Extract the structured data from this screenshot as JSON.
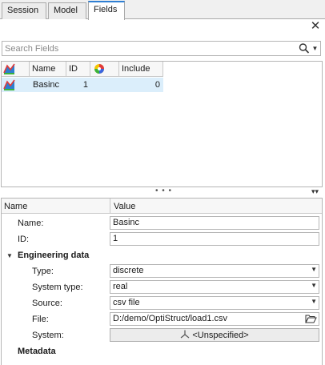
{
  "tabs": [
    {
      "label": "Session"
    },
    {
      "label": "Model"
    },
    {
      "label": "Fields",
      "active": true
    }
  ],
  "search": {
    "placeholder": "Search Fields"
  },
  "grid": {
    "columns": [
      "Name",
      "ID",
      "Include"
    ],
    "rows": [
      {
        "name": "Basinc",
        "id": "1",
        "include": "0"
      }
    ]
  },
  "properties": {
    "header": {
      "name": "Name",
      "value": "Value"
    },
    "name_label": "Name:",
    "name_value": "Basinc",
    "id_label": "ID:",
    "id_value": "1",
    "engineering_group": "Engineering data",
    "type_label": "Type:",
    "type_value": "discrete",
    "system_type_label": "System type:",
    "system_type_value": "real",
    "source_label": "Source:",
    "source_value": "csv file",
    "file_label": "File:",
    "file_value": "D:/demo/OptiStruct/load1.csv",
    "system_label": "System:",
    "system_value": "<Unspecified>",
    "metadata_group": "Metadata"
  },
  "colors": {
    "accent": "#2f7fd3",
    "selection": "#dbeefb"
  }
}
